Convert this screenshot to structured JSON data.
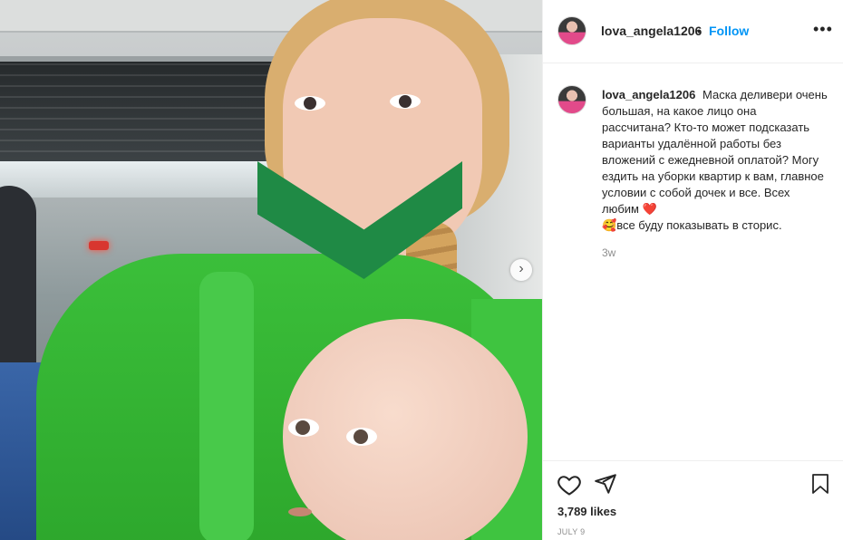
{
  "post": {
    "username": "lova_angela1206",
    "dot": "•",
    "follow_label": "Follow",
    "more_label": "•••",
    "caption_text": "Маска деливери очень большая, на какое лицо она рассчитана? Кто-то может подсказать варианты удалённой работы без вложений с ежедневной оплатой? Могу ездить на уборки квартир к вам, главное условии с собой дочек и все. Всех любим",
    "heart_emoji": "❤️",
    "smile_emoji": "🥰",
    "caption_tail": "все буду показывать в сторис.",
    "time_ago": "3w",
    "likes": "3,789 likes",
    "date": "JULY 9",
    "next_label": "›"
  },
  "icons": {
    "like": "heart-outline-icon",
    "share": "paper-plane-icon",
    "save": "bookmark-outline-icon",
    "next": "chevron-right-icon"
  },
  "colors": {
    "follow": "#0095f6",
    "text": "#262626",
    "muted": "#8e8e8e",
    "border": "#efefef"
  }
}
